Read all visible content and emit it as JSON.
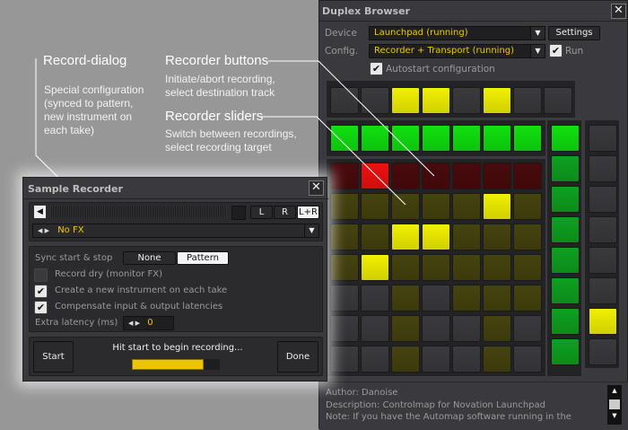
{
  "annotations": {
    "record_dialog": {
      "title": "Record-dialog",
      "desc": [
        "Special configuration",
        "(synced to pattern,",
        "new instrument on",
        "each take)"
      ]
    },
    "recorder_buttons": {
      "title": "Recorder buttons",
      "desc": [
        "Initiate/abort recording,",
        "select destination track"
      ]
    },
    "recorder_sliders": {
      "title": "Recorder sliders",
      "desc": [
        "Switch between recordings,",
        "select recording target"
      ]
    }
  },
  "browser": {
    "title": "Duplex Browser",
    "device_label": "Device",
    "device_value": "Launchpad (running)",
    "settings_label": "Settings",
    "config_label": "Config.",
    "config_value": "Recorder + Transport (running)",
    "run_label": "Run",
    "run_checked": true,
    "autostart_label": "Autostart configuration",
    "autostart_checked": true,
    "top_row": [
      "off",
      "off",
      "yellow",
      "yellow",
      "off",
      "yellow",
      "off",
      "off"
    ],
    "green_row": [
      "green",
      "green",
      "green",
      "green",
      "green",
      "green",
      "green"
    ],
    "grid": [
      [
        "darkred",
        "red",
        "darkred",
        "darkred",
        "darkred",
        "darkred",
        "darkred"
      ],
      [
        "olive",
        "olive",
        "olive",
        "olive",
        "olive",
        "yellow",
        "olive"
      ],
      [
        "olive",
        "olive",
        "yellow",
        "yellow",
        "olive",
        "olive",
        "olive"
      ],
      [
        "olive",
        "yellow",
        "olive",
        "olive",
        "olive",
        "olive",
        "olive"
      ],
      [
        "off",
        "off",
        "olive",
        "off",
        "olive",
        "olive",
        "olive"
      ],
      [
        "off",
        "off",
        "olive",
        "off",
        "off",
        "olive",
        "off"
      ],
      [
        "off",
        "off",
        "olive",
        "off",
        "off",
        "olive",
        "off"
      ]
    ],
    "right_col": [
      "green",
      "dimgreen",
      "dimgreen",
      "dimgreen",
      "dimgreen",
      "dimgreen",
      "dimgreen",
      "dimgreen"
    ],
    "far_right_col": [
      "off",
      "off",
      "off",
      "off",
      "off",
      "off",
      "yellow",
      "off"
    ],
    "info": [
      "Author: Danoise",
      "Description: Controlmap for Novation Launchpad",
      "Note: If you have the Automap software running in the"
    ]
  },
  "recorder": {
    "title": "Sample Recorder",
    "channels": [
      "L",
      "R",
      "L+R"
    ],
    "active_channel": "L+R",
    "fx_value": "No FX",
    "sync_label": "Sync start & stop",
    "sync_options": [
      "None",
      "Pattern"
    ],
    "sync_selected": "Pattern",
    "record_dry_label": "Record dry (monitor FX)",
    "record_dry_checked": false,
    "new_instrument_label": "Create a new instrument on each take",
    "new_instrument_checked": true,
    "compensate_label": "Compensate input & output latencies",
    "compensate_checked": true,
    "latency_label": "Extra latency (ms)",
    "latency_value": "0",
    "start_label": "Start",
    "done_label": "Done",
    "status": "Hit start to begin recording...",
    "progress": 0.82
  },
  "colors": {
    "off": "#3a3a3e",
    "yellow": "#f0f000",
    "olive": "#45430f",
    "darkred": "#4a0a0c",
    "red": "#ee1010",
    "green": "#10e010",
    "dimgreen": "#0ea020",
    "accent": "#f0c800"
  }
}
